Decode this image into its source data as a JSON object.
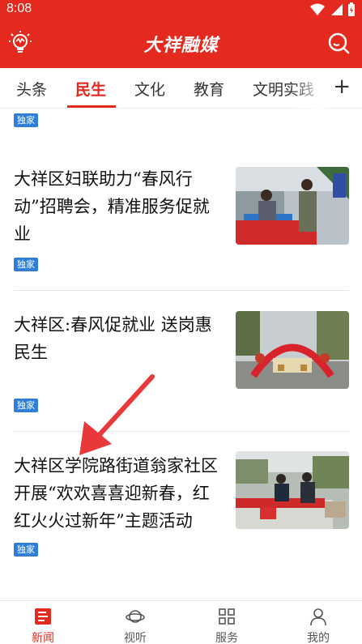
{
  "status": {
    "time": "8:08"
  },
  "app": {
    "title": "大祥融媒"
  },
  "tabs": [
    {
      "label": "头条"
    },
    {
      "label": "民生"
    },
    {
      "label": "文化"
    },
    {
      "label": "教育"
    },
    {
      "label": "文明实践"
    }
  ],
  "add_tab": "+",
  "articles": [
    {
      "title": "",
      "badge": "独家"
    },
    {
      "title_lines": [
        "大祥区妇联助力“春风行",
        "动”招聘会，精准服务促就",
        "业"
      ],
      "badge": "独家"
    },
    {
      "title_lines": [
        "大祥区:春风促就业 送岗惠",
        "民生"
      ],
      "badge": "独家"
    },
    {
      "title_lines": [
        "大祥区学院路街道翁家社区",
        "开展“欢欢喜喜迎新春，红",
        "红火火过新年”主题活动"
      ],
      "badge": "独家"
    }
  ],
  "bottom_nav": [
    {
      "label": "新闻",
      "icon": "news-icon"
    },
    {
      "label": "视听",
      "icon": "planet-icon"
    },
    {
      "label": "服务",
      "icon": "grid-icon"
    },
    {
      "label": "我的",
      "icon": "user-icon"
    }
  ],
  "colors": {
    "brand": "#e42a1e",
    "badge": "#2f7fd8"
  }
}
